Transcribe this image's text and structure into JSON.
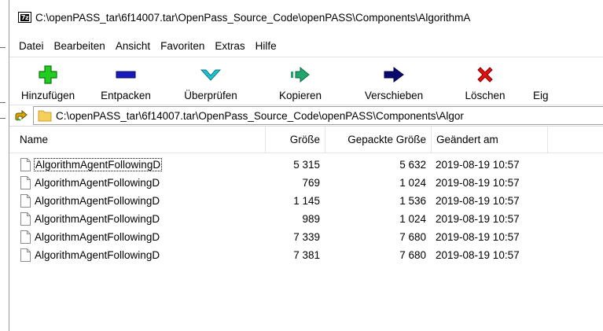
{
  "window": {
    "title": "C:\\openPASS_tar\\6f14007.tar\\OpenPass_Source_Code\\openPASS\\Components\\AlgorithmA",
    "app_icon_text": "7z"
  },
  "menu": [
    "Datei",
    "Bearbeiten",
    "Ansicht",
    "Favoriten",
    "Extras",
    "Hilfe"
  ],
  "toolbar": [
    {
      "label": "Hinzufügen",
      "icon": "add-plus-icon",
      "color": "#22cc22"
    },
    {
      "label": "Entpacken",
      "icon": "extract-minus-icon",
      "color": "#1a1ab8"
    },
    {
      "label": "Überprüfen",
      "icon": "test-chevron-icon",
      "color": "#22c0cc"
    },
    {
      "label": "Kopieren",
      "icon": "copy-arrow-icon",
      "color": "#22a66e"
    },
    {
      "label": "Verschieben",
      "icon": "move-arrow-icon",
      "color": "#0a0a6e"
    },
    {
      "label": "Löschen",
      "icon": "delete-x-icon",
      "color": "#e01010"
    },
    {
      "label": "Eig",
      "icon": "info-icon",
      "color": "#1a1ab8"
    }
  ],
  "address": {
    "path": "C:\\openPASS_tar\\6f14007.tar\\OpenPass_Source_Code\\openPASS\\Components\\Algor"
  },
  "columns": {
    "name": "Name",
    "size": "Größe",
    "packed": "Gepackte Größe",
    "modified": "Geändert am"
  },
  "files": [
    {
      "name": "AlgorithmAgentFollowingD",
      "size": "5 315",
      "packed": "5 632",
      "modified": "2019-08-19 10:57"
    },
    {
      "name": "AlgorithmAgentFollowingD",
      "size": "769",
      "packed": "1 024",
      "modified": "2019-08-19 10:57"
    },
    {
      "name": "AlgorithmAgentFollowingD",
      "size": "1 145",
      "packed": "1 536",
      "modified": "2019-08-19 10:57"
    },
    {
      "name": "AlgorithmAgentFollowingD",
      "size": "989",
      "packed": "1 024",
      "modified": "2019-08-19 10:57"
    },
    {
      "name": "AlgorithmAgentFollowingD",
      "size": "7 339",
      "packed": "7 680",
      "modified": "2019-08-19 10:57"
    },
    {
      "name": "AlgorithmAgentFollowingD",
      "size": "7 381",
      "packed": "7 680",
      "modified": "2019-08-19 10:57"
    }
  ]
}
